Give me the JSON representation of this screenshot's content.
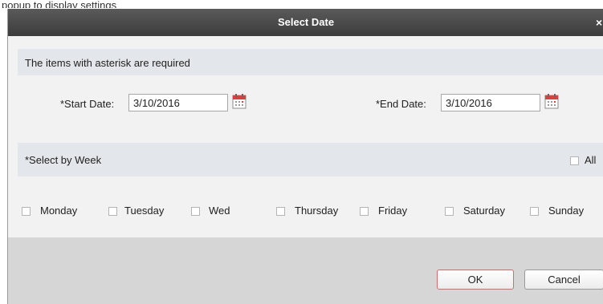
{
  "top_partial_text": "popup to display settings",
  "dialog": {
    "title": "Select Date",
    "close_glyph": "×",
    "notice": "The items with asterisk are required",
    "start_date_label": "*Start Date:",
    "start_date_value": "3/10/2016",
    "end_date_label": "*End Date:",
    "end_date_value": "3/10/2016",
    "week_section_label": "*Select by Week",
    "all_label": "All",
    "days": [
      "Monday",
      "Tuesday",
      "Wed",
      "Thursday",
      "Friday",
      "Saturday",
      "Sunday"
    ],
    "ok_label": "OK",
    "cancel_label": "Cancel"
  },
  "icons": {
    "calendar": "calendar-icon",
    "close": "close-icon",
    "checkbox": "checkbox"
  },
  "colors": {
    "titlebar": "#4a4a4a",
    "dialog_bg": "#f2f2f2",
    "band_bg": "#e3e6ea",
    "footer_bg": "#d6d6d6",
    "ok_border": "#d46a6a",
    "calendar_red": "#d94141"
  }
}
